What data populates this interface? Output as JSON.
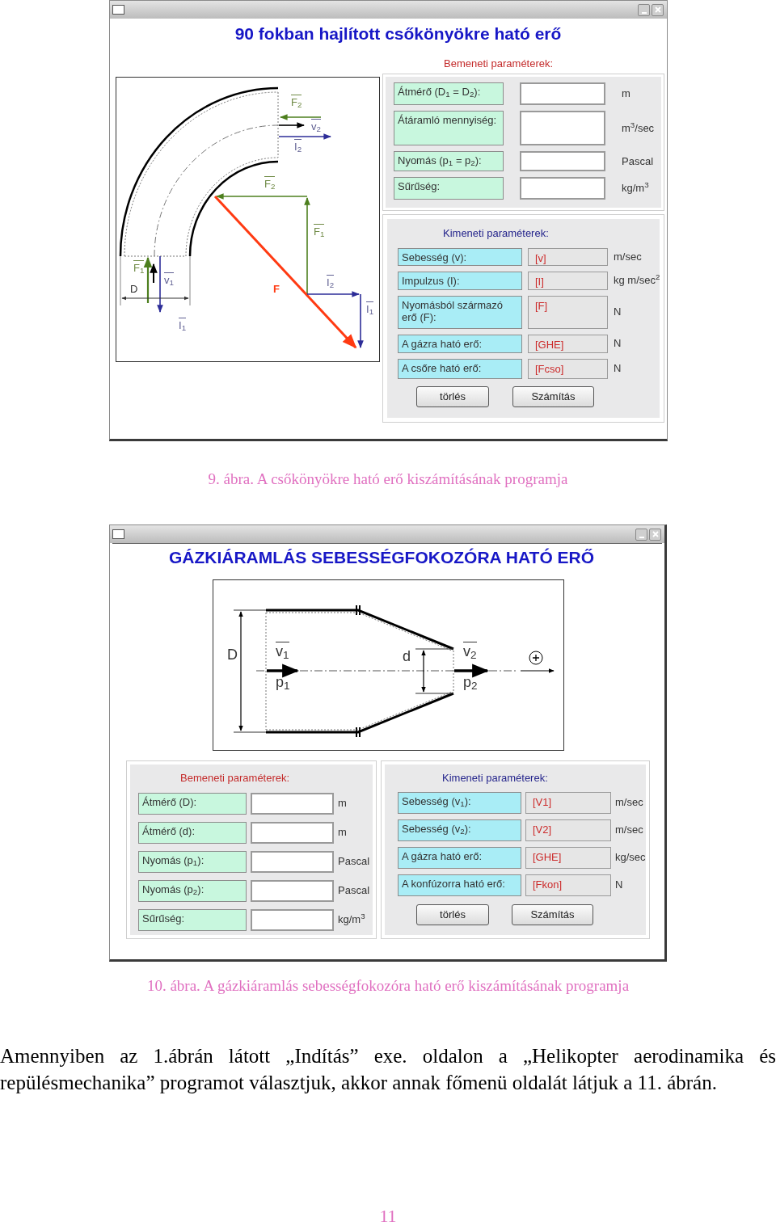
{
  "figures": [
    {
      "kind": "elbow",
      "window": {
        "title": "90 fokban hajlított csőkönyökre ható erő"
      },
      "diagram": {
        "labels": [
          {
            "text": "F$_{2}$",
            "kind": "force",
            "vector": true
          },
          {
            "text": "v$_{2}$",
            "kind": "velocity",
            "vector": true
          },
          {
            "text": "I$_{2}$",
            "kind": "momentum",
            "vector": true
          },
          {
            "text": "F$_{2}$",
            "kind": "force",
            "vector": true
          },
          {
            "text": "F$_{1}$",
            "kind": "force",
            "vector": true
          },
          {
            "text": "F",
            "kind": "resultant",
            "vector": false
          },
          {
            "text": "I$_{2}$",
            "kind": "momentum",
            "vector": true
          },
          {
            "text": "I$_{1}$",
            "kind": "momentum",
            "vector": true
          },
          {
            "text": "F$_{1}$",
            "kind": "force",
            "vector": true
          },
          {
            "text": "D",
            "kind": "dimension",
            "vector": false
          },
          {
            "text": "v$_{1}$",
            "kind": "velocity",
            "vector": true
          },
          {
            "text": "I$_{1}$",
            "kind": "momentum",
            "vector": true
          }
        ]
      },
      "inputs": {
        "title": "Bemeneti paraméterek:",
        "rows": [
          {
            "label": "Átmérő  (D$_{1}$ = D$_{2}$):",
            "unit": "m"
          },
          {
            "label": "Átáramló mennyiség:",
            "unit": "m$^{3}$/sec"
          },
          {
            "label": "Nyomás (p$_{1}$ = p$_{2}$):",
            "unit": "Pascal"
          },
          {
            "label": "Sűrűség:",
            "unit": "kg/m$^{3}$"
          }
        ]
      },
      "outputs": {
        "title": "Kimeneti paraméterek:",
        "rows": [
          {
            "label": "Sebesség (v):",
            "value": "[v]",
            "unit": "m/sec"
          },
          {
            "label": "Impulzus (I):",
            "value": "[I]",
            "unit": "kg m/sec$^{2}$"
          },
          {
            "label": "Nyomásból származó erő (F):",
            "value": "[F]",
            "unit": "N"
          },
          {
            "label": "A gázra ható erő:",
            "value": "[GHE]",
            "unit": "N"
          },
          {
            "label": "A csőre ható erő:",
            "value": "[Fcso]",
            "unit": "N"
          }
        ]
      },
      "buttons": [
        "törlés",
        "Számítás"
      ],
      "caption": "9. ábra. A csőkönyökre ható erő kiszámításának programja"
    },
    {
      "kind": "nozzle",
      "window": {
        "title": "GÁZKIÁRAMLÁS SEBESSÉGFOKOZÓRA HATÓ ERŐ"
      },
      "diagram": {
        "labels": [
          {
            "text": "D",
            "kind": "dimension",
            "vector": false
          },
          {
            "text": "v$_{1}$",
            "kind": "dimension",
            "vector": true
          },
          {
            "text": "p$_{1}$",
            "kind": "dimension",
            "vector": false
          },
          {
            "text": "d",
            "kind": "dimension",
            "vector": false
          },
          {
            "text": "v$_{2}$",
            "kind": "dimension",
            "vector": true
          },
          {
            "text": "p$_{2}$",
            "kind": "dimension",
            "vector": false
          }
        ]
      },
      "inputs": {
        "title": "Bemeneti paraméterek:",
        "rows": [
          {
            "label": "Átmérő  (D):",
            "unit": "m"
          },
          {
            "label": "Átmérő (d):",
            "unit": "m"
          },
          {
            "label": "Nyomás (p$_{1}$):",
            "unit": "Pascal"
          },
          {
            "label": "Nyomás (p$_{2}$):",
            "unit": "Pascal"
          },
          {
            "label": "Sűrűség:",
            "unit": "kg/m$^{3}$"
          }
        ]
      },
      "outputs": {
        "title": "Kimeneti paraméterek:",
        "rows": [
          {
            "label": "Sebesség (v$_{1}$):",
            "value": "[V1]",
            "unit": "m/sec"
          },
          {
            "label": "Sebesség (v$_{2}$):",
            "value": "[V2]",
            "unit": "m/sec"
          },
          {
            "label": "A gázra ható erő:",
            "value": "[GHE]",
            "unit": "kg/sec"
          },
          {
            "label": "A konfúzorra ható erő:",
            "value": "[Fkon]",
            "unit": "N"
          }
        ]
      },
      "buttons": [
        "törlés",
        "Számítás"
      ],
      "caption": "10. ábra. A gázkiáramlás sebességfokozóra ható erő kiszámításának programja"
    }
  ],
  "paragraph": "Amennyiben az 1.ábrán látott „Indítás” exe. oldalon a „Helikopter aerodinamika és repülésmechanika” programot választjuk, akkor annak főmenü oldalát látjuk a 11. ábrán.",
  "page_number": "11"
}
